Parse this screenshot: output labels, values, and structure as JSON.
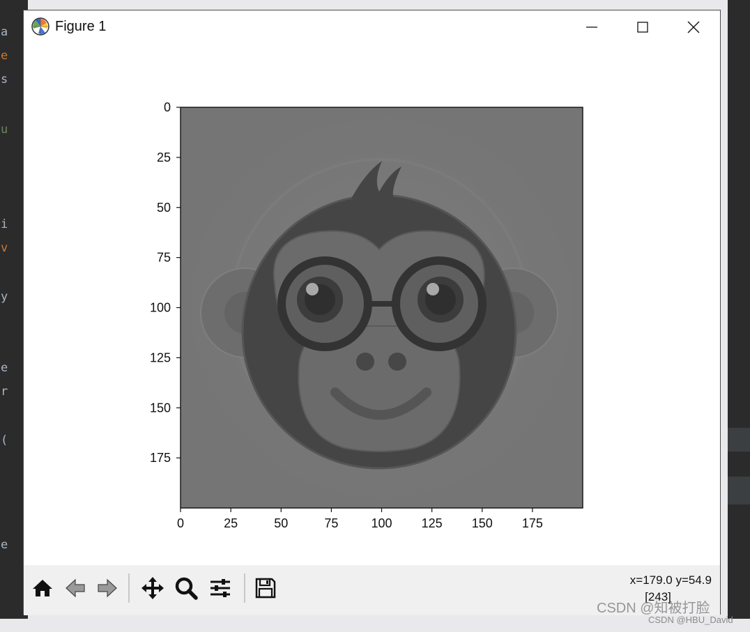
{
  "window": {
    "title": "Figure 1",
    "controls": [
      "minimize",
      "maximize",
      "close"
    ]
  },
  "background_code": [
    "a",
    "e",
    "s",
    "u",
    "i",
    "v",
    "y",
    "e",
    "r",
    "(",
    "e"
  ],
  "chart_data": {
    "type": "image",
    "image_shape": [
      200,
      200
    ],
    "colormap": "gray",
    "subject": "monkey face with round glasses",
    "xticks": [
      0,
      25,
      50,
      75,
      100,
      125,
      150,
      175
    ],
    "yticks": [
      0,
      25,
      50,
      75,
      100,
      125,
      150,
      175
    ],
    "xlim": [
      0,
      200
    ],
    "ylim": [
      200,
      0
    ],
    "title": "",
    "xlabel": "",
    "ylabel": ""
  },
  "toolbar": {
    "buttons": [
      {
        "name": "home",
        "icon": "home-icon"
      },
      {
        "name": "back",
        "icon": "arrow-left-icon"
      },
      {
        "name": "forward",
        "icon": "arrow-right-icon"
      },
      {
        "name": "pan",
        "icon": "move-icon"
      },
      {
        "name": "zoom",
        "icon": "magnifier-icon"
      },
      {
        "name": "configure-subplots",
        "icon": "sliders-icon"
      },
      {
        "name": "save",
        "icon": "floppy-icon"
      }
    ],
    "coordinates": "x=179.0 y=54.9",
    "pixel_value": "[243]"
  },
  "watermark": {
    "line1": "CSDN @知被打脸",
    "line2": "CSDN @HBU_David"
  }
}
